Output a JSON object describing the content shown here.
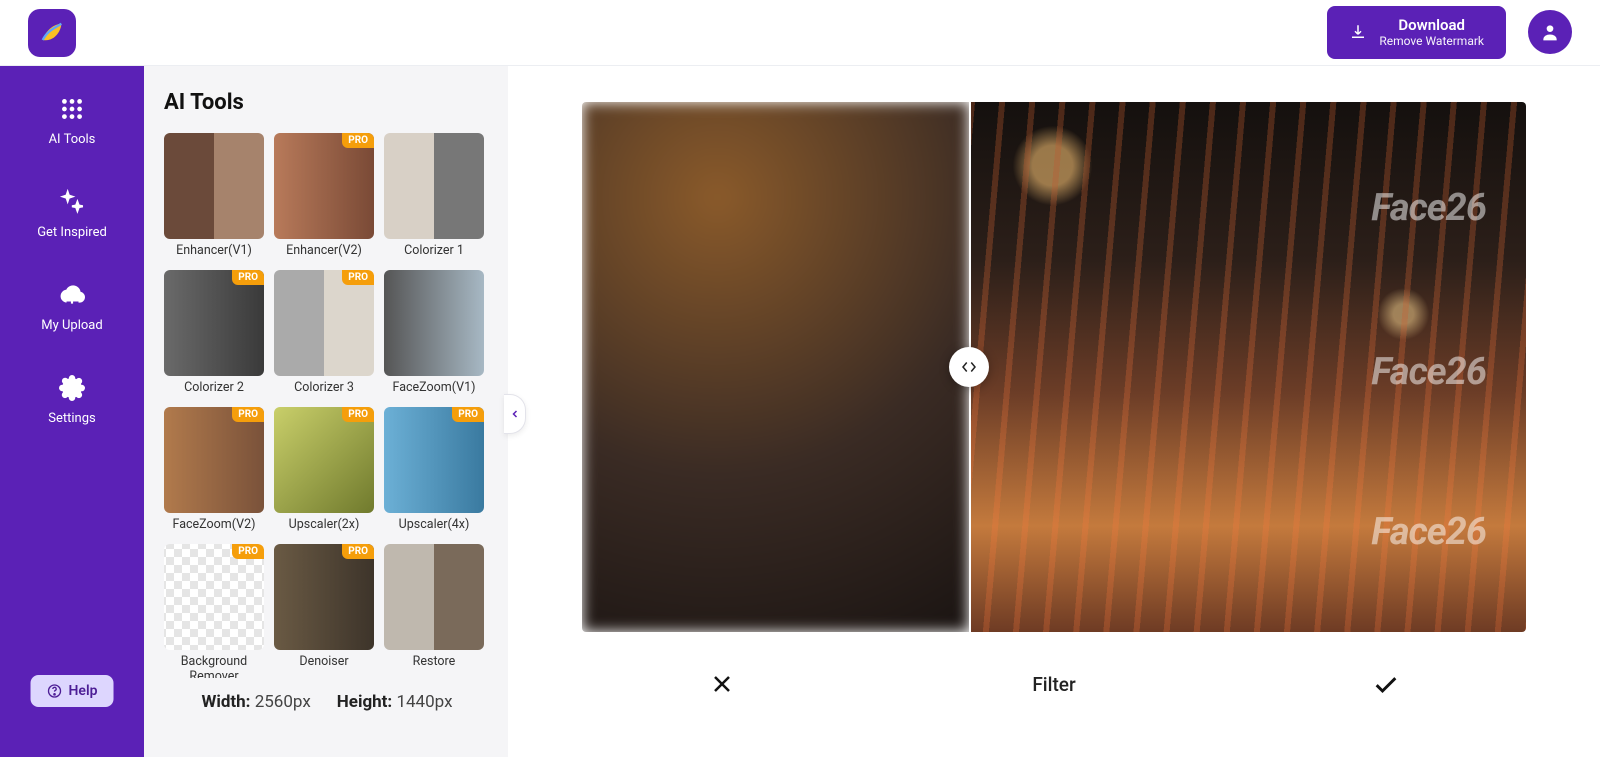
{
  "header": {
    "download_title": "Download",
    "download_sub": "Remove Watermark"
  },
  "sidebar": {
    "items": [
      {
        "label": "AI Tools"
      },
      {
        "label": "Get Inspired"
      },
      {
        "label": "My Upload"
      },
      {
        "label": "Settings"
      }
    ],
    "help_label": "Help"
  },
  "panel": {
    "title": "AI Tools",
    "tools": [
      {
        "label": "Enhancer(V1)",
        "pro": false
      },
      {
        "label": "Enhancer(V2)",
        "pro": true
      },
      {
        "label": "Colorizer 1",
        "pro": false
      },
      {
        "label": "Colorizer 2",
        "pro": true
      },
      {
        "label": "Colorizer 3",
        "pro": true
      },
      {
        "label": "FaceZoom(V1)",
        "pro": false
      },
      {
        "label": "FaceZoom(V2)",
        "pro": true
      },
      {
        "label": "Upscaler(2x)",
        "pro": true
      },
      {
        "label": "Upscaler(4x)",
        "pro": true
      },
      {
        "label": "Background Remover",
        "pro": true
      },
      {
        "label": "Denoiser",
        "pro": true
      },
      {
        "label": "Restore",
        "pro": false
      }
    ],
    "pro_badge": "PRO",
    "width_label": "Width:",
    "width_value": "2560px",
    "height_label": "Height:",
    "height_value": "1440px"
  },
  "viewer": {
    "watermark": "Face26",
    "filter_label": "Filter"
  }
}
